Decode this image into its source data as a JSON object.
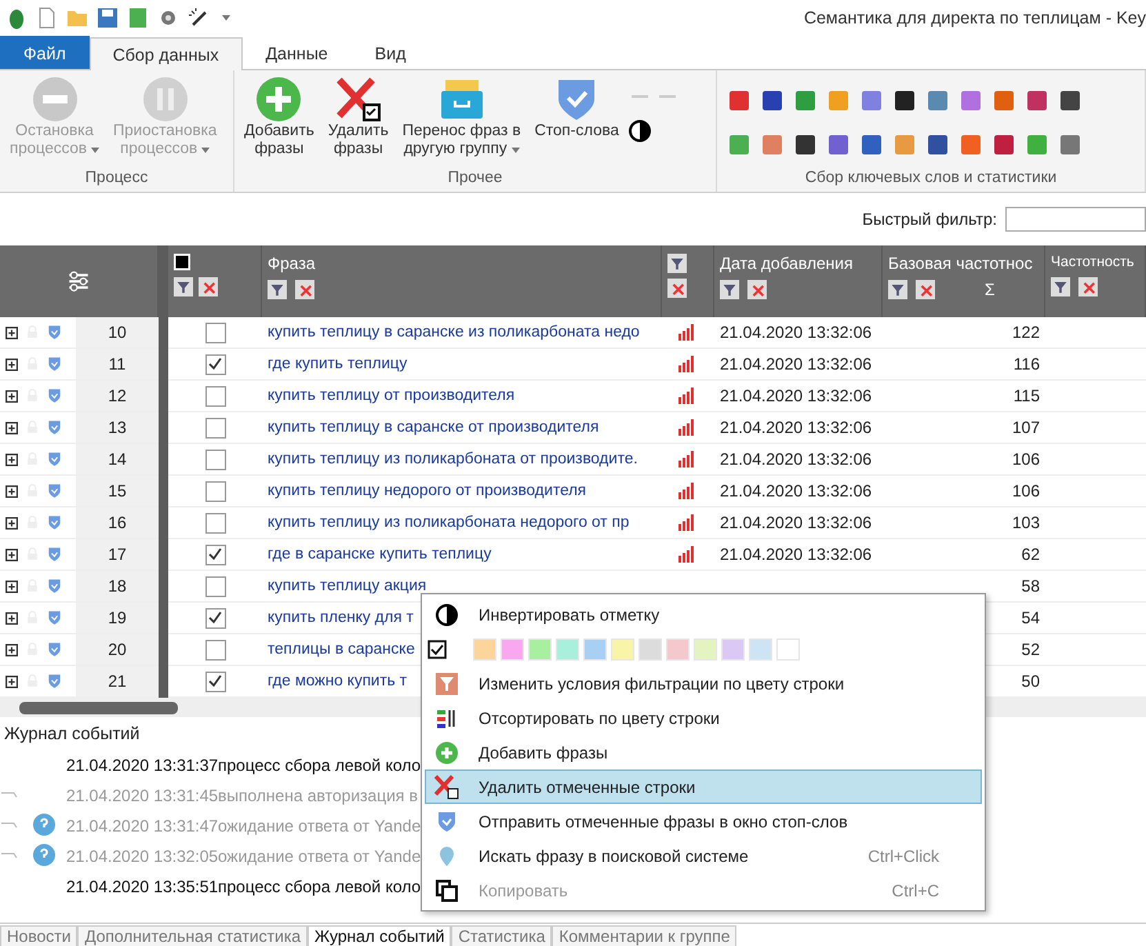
{
  "app": {
    "title": "Семантика для директа по теплицам - Key"
  },
  "ribbon_tabs": [
    {
      "label": "Файл",
      "kind": "file",
      "selected": false
    },
    {
      "label": "Сбор данных",
      "kind": "tab",
      "selected": true
    },
    {
      "label": "Данные",
      "kind": "tab",
      "selected": false
    },
    {
      "label": "Вид",
      "kind": "tab",
      "selected": false
    }
  ],
  "ribbon_groups": [
    {
      "label": "Процесс",
      "buttons": [
        {
          "kind": "stop",
          "lines": [
            "Остановка",
            "процессов"
          ],
          "dropdown": true,
          "disabled": true
        },
        {
          "kind": "pause",
          "lines": [
            "Приостановка",
            "процессов"
          ],
          "dropdown": true,
          "disabled": true
        }
      ]
    },
    {
      "label": "Прочее",
      "buttons": [
        {
          "kind": "add",
          "lines": [
            "Добавить",
            "фразы"
          ],
          "dropdown": false,
          "disabled": false
        },
        {
          "kind": "delete",
          "lines": [
            "Удалить",
            "фразы"
          ],
          "dropdown": false,
          "disabled": false
        },
        {
          "kind": "move",
          "lines": [
            "Перенос фраз в",
            "другую группу"
          ],
          "dropdown": true,
          "disabled": false
        },
        {
          "kind": "shield",
          "lines": [
            "Стоп-слова"
          ],
          "dropdown": false,
          "disabled": false
        }
      ]
    },
    {
      "label": "Сбор ключевых слов и статистики",
      "kind": "tools"
    }
  ],
  "quick_filter": {
    "label": "Быстрый фильтр:"
  },
  "table": {
    "columns": [
      {
        "label": "Фраза"
      },
      {
        "label": "Дата добавления"
      },
      {
        "label": "Базовая частотнос",
        "sum_sign": "Σ"
      },
      {
        "label": "Частотность"
      }
    ],
    "rows": [
      {
        "n": "10",
        "checked": false,
        "phrase": "купить теплицу в саранске из поликарбоната недо",
        "date": "21.04.2020 13:32:06",
        "base": "122"
      },
      {
        "n": "11",
        "checked": true,
        "phrase": "где купить теплицу",
        "date": "21.04.2020 13:32:06",
        "base": "116"
      },
      {
        "n": "12",
        "checked": false,
        "phrase": "купить теплицу от производителя",
        "date": "21.04.2020 13:32:06",
        "base": "115"
      },
      {
        "n": "13",
        "checked": false,
        "phrase": "купить теплицу в саранске от производителя",
        "date": "21.04.2020 13:32:06",
        "base": "107"
      },
      {
        "n": "14",
        "checked": false,
        "phrase": "купить теплицу из поликарбоната от производите.",
        "date": "21.04.2020 13:32:06",
        "base": "106"
      },
      {
        "n": "15",
        "checked": false,
        "phrase": "купить теплицу недорого от производителя",
        "date": "21.04.2020 13:32:06",
        "base": "106"
      },
      {
        "n": "16",
        "checked": false,
        "phrase": "купить теплицу из поликарбоната недорого от пр",
        "date": "21.04.2020 13:32:06",
        "base": "103"
      },
      {
        "n": "17",
        "checked": true,
        "phrase": "где в саранске купить теплицу",
        "date": "21.04.2020 13:32:06",
        "base": "62"
      },
      {
        "n": "18",
        "checked": false,
        "phrase": "купить теплицу акция",
        "base": "58"
      },
      {
        "n": "19",
        "checked": true,
        "phrase": "купить пленку для т",
        "base": "54"
      },
      {
        "n": "20",
        "checked": false,
        "phrase": "теплицы в саранске",
        "base": "52"
      },
      {
        "n": "21",
        "checked": true,
        "phrase": "где можно купить т",
        "base": "50"
      }
    ]
  },
  "event_log": {
    "title": "Журнал событий",
    "entries": [
      {
        "kind": "main",
        "time": "21.04.2020 13:31:37",
        "text": "процесс сбора левой коло"
      },
      {
        "kind": "sub",
        "time": "21.04.2020 13:31:45",
        "text": "выполнена авторизация в"
      },
      {
        "kind": "question",
        "time": "21.04.2020 13:31:47",
        "text": "ожидание ответа от Yande"
      },
      {
        "kind": "question",
        "time": "21.04.2020 13:32:05",
        "text": "ожидание ответа от Yande"
      },
      {
        "kind": "main",
        "time": "21.04.2020 13:35:51",
        "text": "процесс сбора левой коло"
      }
    ]
  },
  "context_menu": {
    "items": [
      {
        "kind": "invert",
        "label": "Инвертировать отметку",
        "selected": false,
        "disabled": false
      },
      {
        "kind": "colors",
        "swatches": [
          {
            "color": "#fdd49a"
          },
          {
            "color": "#f9a8f0"
          },
          {
            "color": "#a8f0a0"
          },
          {
            "color": "#a8f0dc"
          },
          {
            "color": "#a8d0f4"
          },
          {
            "color": "#f8f4a8"
          },
          {
            "color": "#dcdcdc"
          },
          {
            "color": "#f4c8cc"
          },
          {
            "color": "#e4f4c0"
          },
          {
            "color": "#dcc8f4"
          },
          {
            "color": "#cce4f4"
          },
          {
            "color": "#ffffff"
          }
        ]
      },
      {
        "kind": "filter",
        "label": "Изменить условия фильтрации по цвету строки",
        "selected": false,
        "disabled": false
      },
      {
        "kind": "sort",
        "label": "Отсортировать по цвету строки",
        "selected": false,
        "disabled": false
      },
      {
        "kind": "add",
        "label": "Добавить фразы",
        "selected": false,
        "disabled": false
      },
      {
        "kind": "delete",
        "label": "Удалить отмеченные строки",
        "selected": true,
        "disabled": false
      },
      {
        "kind": "shield",
        "label": "Отправить отмеченные фразы в окно стоп-слов",
        "selected": false,
        "disabled": false
      },
      {
        "kind": "search",
        "label": "Искать фразу в поисковой системе",
        "shortcut": "Ctrl+Click",
        "selected": false,
        "disabled": false
      },
      {
        "kind": "copy",
        "label": "Копировать",
        "shortcut": "Ctrl+C",
        "selected": false,
        "disabled": true
      }
    ]
  },
  "bottom_tabs": [
    {
      "label": "Новости",
      "selected": false
    },
    {
      "label": "Дополнительная статистика",
      "selected": false
    },
    {
      "label": "Журнал событий",
      "selected": true
    },
    {
      "label": "Статистика",
      "selected": false
    },
    {
      "label": "Комментарии к группе",
      "selected": false
    }
  ]
}
